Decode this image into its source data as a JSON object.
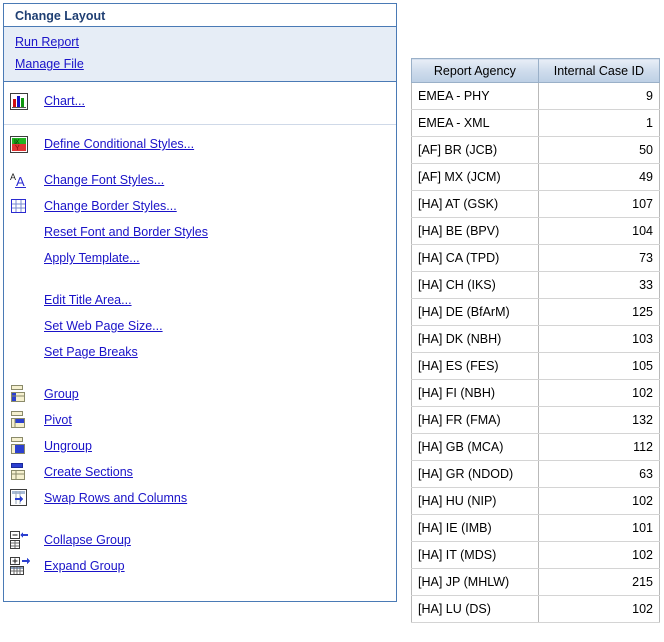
{
  "panel": {
    "title": "Change Layout",
    "top_links": [
      {
        "label": "Run Report",
        "icon": "none"
      },
      {
        "label": "Manage File",
        "icon": "none"
      }
    ],
    "groups": [
      {
        "items": [
          {
            "label": "Chart...",
            "icon": "bar-chart-icon"
          }
        ]
      },
      {
        "items": [
          {
            "label": "Define Conditional Styles...",
            "icon": "conditional-styles-icon"
          }
        ]
      },
      {
        "items": [
          {
            "label": "Change Font Styles...",
            "icon": "font-styles-icon"
          },
          {
            "label": "Change Border Styles...",
            "icon": "border-styles-icon"
          },
          {
            "label": "Reset Font and Border Styles",
            "icon": "none"
          },
          {
            "label": "Apply Template...",
            "icon": "none"
          }
        ]
      },
      {
        "items": [
          {
            "label": "Edit Title Area...",
            "icon": "none"
          },
          {
            "label": "Set Web Page Size...",
            "icon": "none"
          },
          {
            "label": "Set Page Breaks",
            "icon": "none"
          }
        ]
      },
      {
        "items": [
          {
            "label": "Group",
            "icon": "group-icon"
          },
          {
            "label": "Pivot",
            "icon": "pivot-icon"
          },
          {
            "label": "Ungroup",
            "icon": "ungroup-icon"
          },
          {
            "label": "Create Sections",
            "icon": "create-sections-icon"
          },
          {
            "label": "Swap Rows and Columns",
            "icon": "swap-rows-columns-icon"
          }
        ]
      },
      {
        "items": [
          {
            "label": "Collapse Group",
            "icon": "collapse-group-icon"
          },
          {
            "label": "Expand Group",
            "icon": "expand-group-icon"
          }
        ]
      }
    ]
  },
  "table": {
    "columns": [
      "Report Agency",
      "Internal Case ID"
    ],
    "rows": [
      [
        "EMEA - PHY",
        "9"
      ],
      [
        "EMEA - XML",
        "1"
      ],
      [
        "[AF] BR (JCB)",
        "50"
      ],
      [
        "[AF] MX (JCM)",
        "49"
      ],
      [
        "[HA] AT (GSK)",
        "107"
      ],
      [
        "[HA] BE (BPV)",
        "104"
      ],
      [
        "[HA] CA (TPD)",
        "73"
      ],
      [
        "[HA] CH (IKS)",
        "33"
      ],
      [
        "[HA] DE (BfArM)",
        "125"
      ],
      [
        "[HA] DK (NBH)",
        "103"
      ],
      [
        "[HA] ES (FES)",
        "105"
      ],
      [
        "[HA] FI (NBH)",
        "102"
      ],
      [
        "[HA] FR (FMA)",
        "132"
      ],
      [
        "[HA] GB (MCA)",
        "112"
      ],
      [
        "[HA] GR (NDOD)",
        "63"
      ],
      [
        "[HA] HU (NIP)",
        "102"
      ],
      [
        "[HA] IE (IMB)",
        "101"
      ],
      [
        "[HA] IT (MDS)",
        "102"
      ],
      [
        "[HA] JP (MHLW)",
        "215"
      ],
      [
        "[HA] LU (DS)",
        "102"
      ]
    ]
  },
  "colors": {
    "panel_border": "#4a7ab5",
    "panel_title_text": "#1f3f73",
    "links_band_bg": "#e6edf6",
    "link_text": "#1a13c8",
    "table_header_bg": "#cfdcec"
  }
}
